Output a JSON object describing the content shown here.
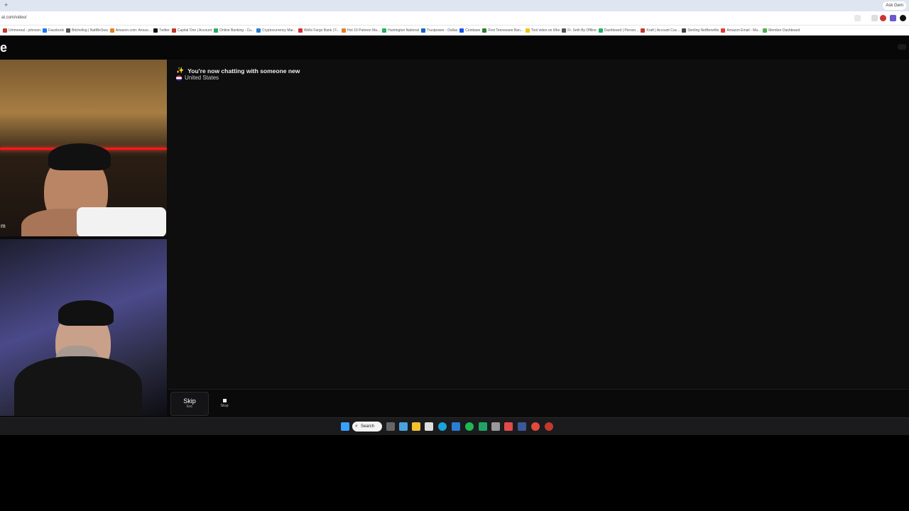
{
  "browser": {
    "new_tab_symbol": "+",
    "ask_button": "Ask Gem",
    "url": "at.com/video/",
    "bookmarks": [
      "Ummereal - johnson",
      "Facebook",
      "Bitchellog | NattBeSwa",
      "Amazon.com: Annuo...",
      "Twitter",
      "Capital One | Account",
      "Online Banking - Cu...",
      "Cryptocurrency Mar...",
      "Wells Fargo Bank | F...",
      "Hot 10 Patreon Ma...",
      "Huntington National",
      "Trustpower - Dallas",
      "Coinbase",
      "First Tennessee Ban...",
      "Tool video on It/ke",
      "Fr. Seth By Offline",
      "Dashboard | Person...",
      "Kraft | Account Cus...",
      "Sterling NetBenefits",
      "Amazon Email - Ma...",
      "Member Dashboard"
    ]
  },
  "site": {
    "logo": "e"
  },
  "cameras": {
    "remote_tag": "m"
  },
  "chat": {
    "sparkle_icon": "✨",
    "system_message": "You're now chatting with someone new",
    "country": "United States"
  },
  "controls": {
    "skip_label": "Skip",
    "skip_key": "Esc",
    "stop_label": "Stop",
    "input_value": ""
  },
  "taskbar": {
    "search_label": "Search"
  },
  "colors": {
    "accent_red_light": "#ff1818",
    "background": "#0e0e0f"
  }
}
